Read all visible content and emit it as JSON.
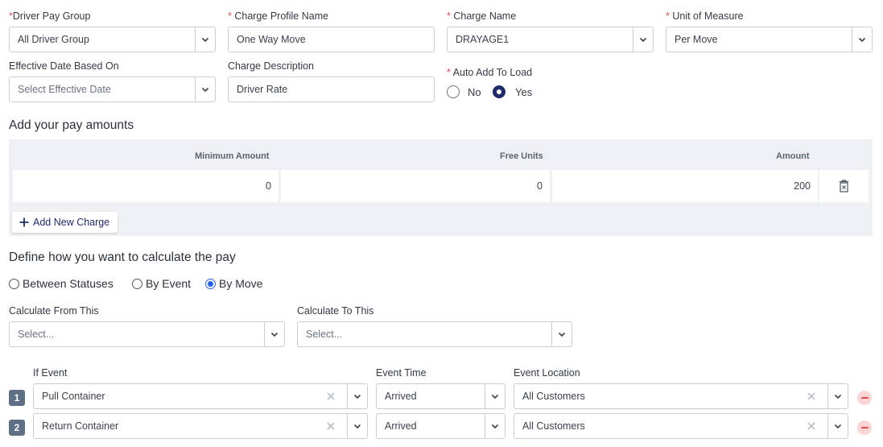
{
  "form": {
    "driver_pay_group": {
      "required_mark": "*",
      "label": "Driver Pay Group",
      "value": "All Driver Group"
    },
    "charge_profile_name": {
      "required_mark": "* ",
      "label": "Charge Profile Name",
      "value": "One Way Move"
    },
    "charge_name": {
      "required_mark": "* ",
      "label": "Charge Name",
      "value": "DRAYAGE1"
    },
    "unit_of_measure": {
      "required_mark": "* ",
      "label": "Unit of Measure",
      "value": "Per Move"
    },
    "effective_date": {
      "label": "Effective Date Based On",
      "placeholder": "Select Effective Date"
    },
    "charge_description": {
      "label": "Charge Description",
      "value": "Driver Rate"
    },
    "auto_add": {
      "required_mark": "* ",
      "label": "Auto Add To Load",
      "options": [
        "No",
        "Yes"
      ],
      "selected": "Yes"
    }
  },
  "pay_amounts": {
    "heading": "Add your pay amounts",
    "columns": [
      "Minimum Amount",
      "Free Units",
      "Amount"
    ],
    "rows": [
      {
        "minimum_amount": "0",
        "free_units": "0",
        "amount": "200"
      }
    ],
    "add_button_label": "Add New Charge"
  },
  "calculation": {
    "heading": "Define how you want to calculate the pay",
    "methods": [
      "Between Statuses",
      "By Event",
      "By Move"
    ],
    "selected_method": "By Move",
    "from_label": "Calculate From This",
    "to_label": "Calculate To This",
    "from_placeholder": "Select...",
    "to_placeholder": "Select..."
  },
  "events": {
    "columns": [
      "If Event",
      "Event Time",
      "Event Location"
    ],
    "rows": [
      {
        "index": "1",
        "event": "Pull Container",
        "time": "Arrived",
        "location": "All Customers"
      },
      {
        "index": "2",
        "event": "Return Container",
        "time": "Arrived",
        "location": "All Customers"
      }
    ]
  },
  "colors": {
    "accent": "#1f2a6b",
    "radio_selected": "#2563eb",
    "danger": "#e5484d",
    "danger_bg": "#fbd5d5",
    "table_bg": "#eef0f4",
    "row_badge": "#5f6f86"
  },
  "icons": {
    "dropdown": "chevron-down-icon",
    "delete_row": "trash-icon",
    "clear": "clear-icon",
    "remove_row": "minus-circle-icon",
    "add": "plus-icon"
  }
}
